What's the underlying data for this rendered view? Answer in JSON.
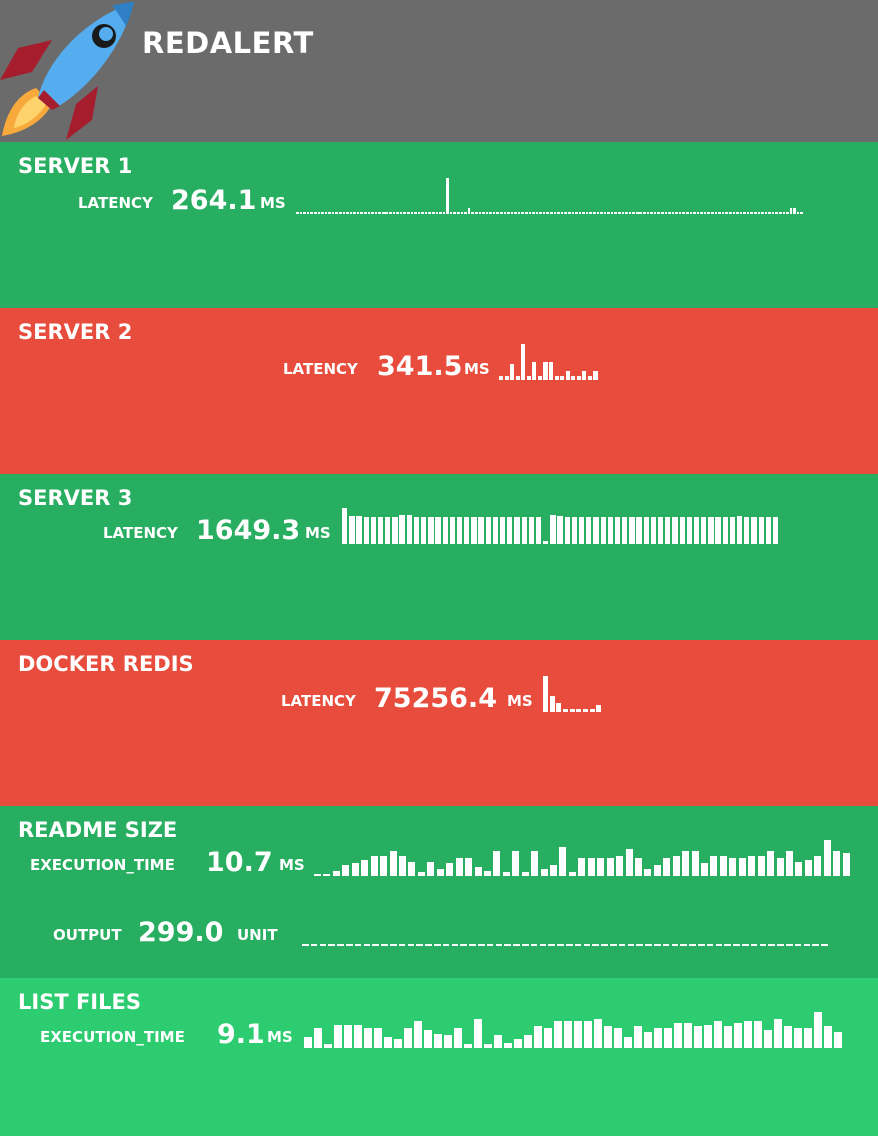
{
  "app": {
    "title": "REDALERT",
    "logo_icon": "rocket-icon"
  },
  "colors": {
    "header_bg": "#6b6b6b",
    "ok": "#27ae60",
    "alert": "#e74c3c",
    "ok_light": "#2ecc71"
  },
  "checks": [
    {
      "name": "SERVER 1",
      "status": "ok",
      "metrics": [
        {
          "label": "LATENCY",
          "value": "264.1",
          "unit": "MS",
          "history": [
            0.05,
            0.05,
            0.05,
            0.05,
            0.05,
            0.05,
            0.05,
            0.05,
            0.05,
            0.05,
            0.05,
            0.05,
            0.05,
            0.05,
            0.05,
            0.05,
            0.05,
            0.05,
            0.05,
            0.05,
            0.05,
            0.05,
            0.05,
            0.05,
            0.05,
            0.05,
            0.05,
            0.05,
            0.05,
            0.05,
            0.05,
            0.05,
            0.05,
            0.05,
            0.05,
            0.05,
            0.05,
            0.05,
            0.05,
            0.05,
            0.05,
            0.05,
            1.0,
            0.05,
            0.05,
            0.05,
            0.05,
            0.05,
            0.18,
            0.05,
            0.05,
            0.05,
            0.05,
            0.05,
            0.05,
            0.05,
            0.05,
            0.05,
            0.05,
            0.05,
            0.05,
            0.05,
            0.05,
            0.05,
            0.05,
            0.05,
            0.05,
            0.05,
            0.05,
            0.05,
            0.05,
            0.05,
            0.05,
            0.05,
            0.05,
            0.05,
            0.05,
            0.05,
            0.05,
            0.05,
            0.05,
            0.05,
            0.05,
            0.05,
            0.05,
            0.05,
            0.05,
            0.05,
            0.05,
            0.05,
            0.05,
            0.05,
            0.05,
            0.05,
            0.05,
            0.05,
            0.05,
            0.05,
            0.05,
            0.05,
            0.05,
            0.05,
            0.05,
            0.05,
            0.05,
            0.05,
            0.05,
            0.05,
            0.05,
            0.05,
            0.05,
            0.05,
            0.05,
            0.05,
            0.05,
            0.05,
            0.05,
            0.05,
            0.05,
            0.05,
            0.05,
            0.05,
            0.05,
            0.05,
            0.05,
            0.05,
            0.05,
            0.05,
            0.05,
            0.05,
            0.05,
            0.05,
            0.05,
            0.05,
            0.05,
            0.05,
            0.05,
            0.05,
            0.18,
            0.18,
            0.05,
            0.05
          ]
        }
      ]
    },
    {
      "name": "SERVER 2",
      "status": "alert",
      "metrics": [
        {
          "label": "LATENCY",
          "value": "341.5",
          "unit": "MS",
          "history": [
            0.1,
            0.1,
            0.45,
            0.1,
            1.0,
            0.1,
            0.5,
            0.1,
            0.5,
            0.5,
            0.1,
            0.1,
            0.25,
            0.1,
            0.1,
            0.25,
            0.1,
            0.25
          ]
        }
      ]
    },
    {
      "name": "SERVER 3",
      "status": "ok",
      "metrics": [
        {
          "label": "LATENCY",
          "value": "1649.3",
          "unit": "MS",
          "history": [
            1.0,
            0.78,
            0.78,
            0.75,
            0.75,
            0.75,
            0.75,
            0.75,
            0.8,
            0.8,
            0.75,
            0.75,
            0.75,
            0.75,
            0.75,
            0.75,
            0.75,
            0.75,
            0.75,
            0.75,
            0.75,
            0.75,
            0.75,
            0.75,
            0.75,
            0.75,
            0.75,
            0.75,
            0.08,
            0.8,
            0.78,
            0.75,
            0.75,
            0.75,
            0.75,
            0.75,
            0.75,
            0.75,
            0.75,
            0.75,
            0.75,
            0.75,
            0.75,
            0.75,
            0.75,
            0.75,
            0.75,
            0.75,
            0.75,
            0.75,
            0.75,
            0.75,
            0.75,
            0.75,
            0.75,
            0.78,
            0.75,
            0.75,
            0.75,
            0.75,
            0.75
          ]
        }
      ]
    },
    {
      "name": "DOCKER REDIS",
      "status": "alert",
      "metrics": [
        {
          "label": "LATENCY",
          "value": "75256.4",
          "unit": "MS",
          "history": [
            1.0,
            0.45,
            0.25,
            0.08,
            0.08,
            0.08,
            0.08,
            0.08,
            0.2
          ]
        }
      ]
    },
    {
      "name": "README SIZE",
      "status": "ok",
      "metrics": [
        {
          "label": "EXECUTION_TIME",
          "value": "10.7",
          "unit": "MS",
          "history": [
            0.05,
            0.05,
            0.15,
            0.3,
            0.35,
            0.45,
            0.55,
            0.55,
            0.7,
            0.55,
            0.4,
            0.1,
            0.4,
            0.2,
            0.35,
            0.5,
            0.5,
            0.25,
            0.15,
            0.7,
            0.1,
            0.7,
            0.1,
            0.7,
            0.2,
            0.3,
            0.8,
            0.1,
            0.5,
            0.5,
            0.5,
            0.5,
            0.55,
            0.75,
            0.5,
            0.2,
            0.3,
            0.5,
            0.55,
            0.7,
            0.7,
            0.35,
            0.55,
            0.55,
            0.5,
            0.5,
            0.55,
            0.55,
            0.7,
            0.5,
            0.7,
            0.4,
            0.45,
            0.55,
            1.0,
            0.7,
            0.65
          ]
        },
        {
          "label": "OUTPUT",
          "value": "299.0",
          "unit": "UNIT",
          "history": [
            0.05,
            0.05,
            0.05,
            0.05,
            0.05,
            0.05,
            0.05,
            0.05,
            0.05,
            0.05,
            0.05,
            0.05,
            0.05,
            0.05,
            0.05,
            0.05,
            0.05,
            0.05,
            0.05,
            0.05,
            0.05,
            0.05,
            0.05,
            0.05,
            0.05,
            0.05,
            0.05,
            0.05,
            0.05,
            0.05,
            0.05,
            0.05,
            0.05,
            0.05,
            0.05,
            0.05,
            0.05,
            0.05,
            0.05,
            0.05,
            0.05,
            0.05,
            0.05,
            0.05,
            0.05,
            0.05,
            0.05,
            0.05,
            0.05,
            0.05,
            0.05,
            0.05,
            0.05,
            0.05,
            0.05,
            0.05,
            0.05,
            0.05,
            0.05,
            0.05
          ]
        }
      ]
    },
    {
      "name": "LIST FILES",
      "status": "ok_light",
      "metrics": [
        {
          "label": "EXECUTION_TIME",
          "value": "9.1",
          "unit": "MS",
          "history": [
            0.3,
            0.55,
            0.1,
            0.65,
            0.65,
            0.65,
            0.55,
            0.55,
            0.3,
            0.25,
            0.55,
            0.75,
            0.5,
            0.4,
            0.35,
            0.55,
            0.1,
            0.8,
            0.1,
            0.35,
            0.15,
            0.25,
            0.35,
            0.6,
            0.55,
            0.75,
            0.75,
            0.75,
            0.75,
            0.8,
            0.6,
            0.55,
            0.3,
            0.6,
            0.45,
            0.55,
            0.55,
            0.7,
            0.7,
            0.6,
            0.65,
            0.75,
            0.6,
            0.7,
            0.75,
            0.75,
            0.5,
            0.8,
            0.6,
            0.55,
            0.55,
            1.0,
            0.6,
            0.45
          ]
        }
      ]
    }
  ]
}
